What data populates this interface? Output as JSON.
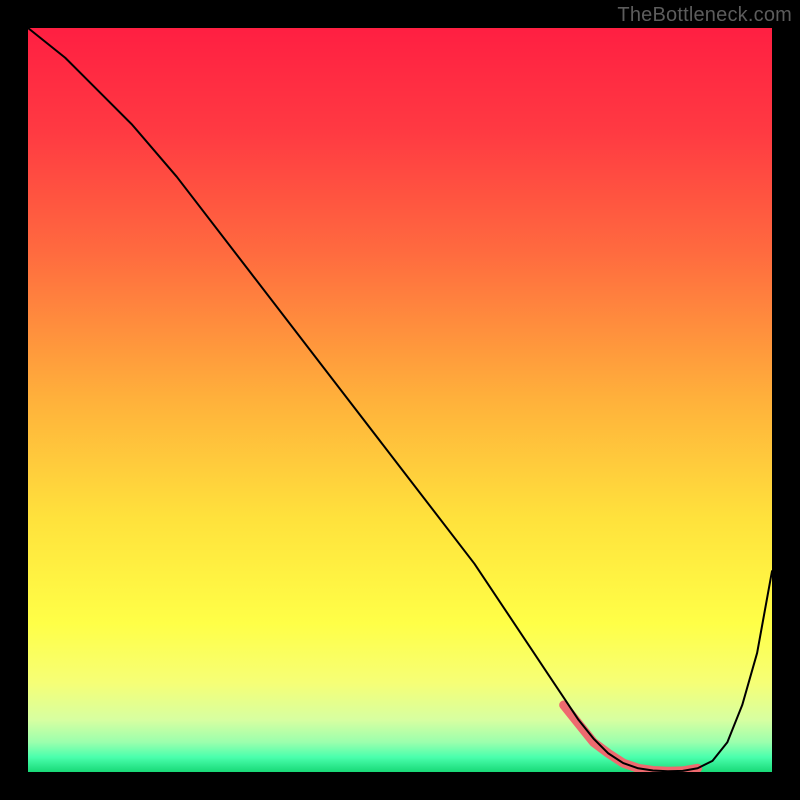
{
  "watermark": "TheBottleneck.com",
  "chart_data": {
    "type": "line",
    "title": "",
    "xlabel": "",
    "ylabel": "",
    "xlim": [
      0,
      100
    ],
    "ylim": [
      0,
      100
    ],
    "grid": false,
    "series": [
      {
        "name": "bottleneck-curve",
        "x": [
          0,
          5,
          8,
          10,
          14,
          20,
          30,
          40,
          50,
          60,
          64,
          68,
          70,
          72,
          74,
          76,
          78,
          80,
          82,
          84,
          86,
          88,
          90,
          92,
          94,
          96,
          98,
          100
        ],
        "y": [
          100,
          96,
          93,
          91,
          87,
          80,
          67,
          54,
          41,
          28,
          22,
          16,
          13,
          10,
          7,
          4.5,
          2.5,
          1.2,
          0.5,
          0.2,
          0.1,
          0.15,
          0.5,
          1.5,
          4,
          9,
          16,
          27
        ]
      },
      {
        "name": "optimal-band",
        "x": [
          72,
          74,
          76,
          78,
          80,
          82,
          84,
          86,
          88,
          90
        ],
        "y": [
          9,
          6.5,
          4,
          2.5,
          1.2,
          0.5,
          0.2,
          0.1,
          0.15,
          0.5
        ]
      }
    ],
    "gradient_stops": [
      {
        "pct": 0,
        "color": "#ff1f42"
      },
      {
        "pct": 14,
        "color": "#ff3a42"
      },
      {
        "pct": 30,
        "color": "#ff6a3f"
      },
      {
        "pct": 50,
        "color": "#ffb13b"
      },
      {
        "pct": 66,
        "color": "#ffe23c"
      },
      {
        "pct": 80,
        "color": "#ffff47"
      },
      {
        "pct": 88,
        "color": "#f6ff76"
      },
      {
        "pct": 93,
        "color": "#d7ffa1"
      },
      {
        "pct": 96,
        "color": "#9bffad"
      },
      {
        "pct": 98,
        "color": "#4affad"
      },
      {
        "pct": 100,
        "color": "#18d977"
      }
    ],
    "colors": {
      "curve": "#000000",
      "optimal": "#ee6a6f"
    }
  }
}
